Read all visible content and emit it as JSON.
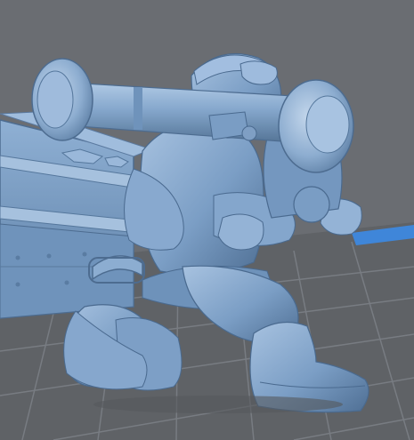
{
  "viewport": {
    "background_color": "#6a6d72",
    "floor_color": "#5f6266",
    "grid_color": "#767a80",
    "bed_edge_color": "#3f86d9",
    "model_color": "#7fa2c8",
    "model_highlight": "#a9c4e2",
    "model_shadow": "#4f6f94",
    "crate_color": "#7196bf"
  },
  "objects": [
    {
      "name": "soldier-miniature",
      "kind": "3d-printable-model"
    },
    {
      "name": "missile-launcher-tube",
      "kind": "3d-printable-model"
    },
    {
      "name": "ammo-crate",
      "kind": "3d-printable-model"
    }
  ]
}
